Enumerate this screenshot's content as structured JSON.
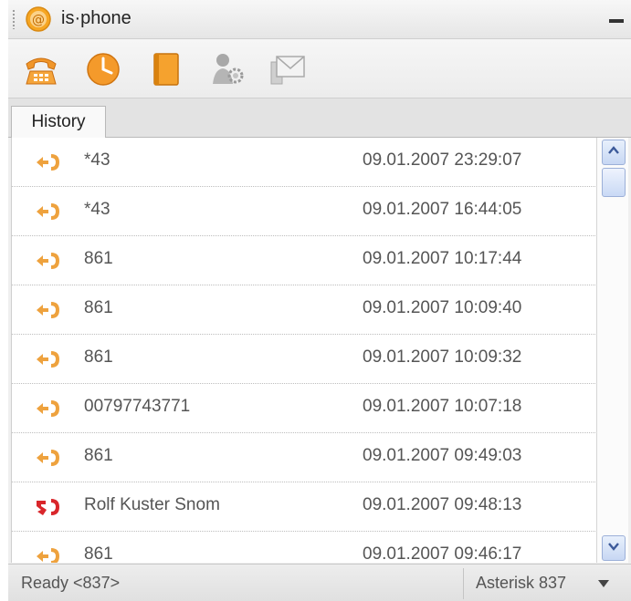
{
  "app": {
    "title": "is·phone"
  },
  "toolbar": {
    "buttons": [
      {
        "icon": "phone-icon"
      },
      {
        "icon": "clock-icon"
      },
      {
        "icon": "address-book-icon"
      },
      {
        "icon": "settings-user-icon"
      },
      {
        "icon": "mail-icon"
      }
    ]
  },
  "tabs": [
    {
      "label": "History"
    }
  ],
  "history": [
    {
      "type": "incoming",
      "name": "*43",
      "time": "09.01.2007 23:29:07"
    },
    {
      "type": "incoming",
      "name": "*43",
      "time": "09.01.2007 16:44:05"
    },
    {
      "type": "incoming",
      "name": "861",
      "time": "09.01.2007 10:17:44"
    },
    {
      "type": "incoming",
      "name": "861",
      "time": "09.01.2007 10:09:40"
    },
    {
      "type": "incoming",
      "name": "861",
      "time": "09.01.2007 10:09:32"
    },
    {
      "type": "incoming",
      "name": "00797743771",
      "time": "09.01.2007 10:07:18"
    },
    {
      "type": "incoming",
      "name": "861",
      "time": "09.01.2007 09:49:03"
    },
    {
      "type": "missed",
      "name": "Rolf Kuster Snom",
      "time": "09.01.2007 09:48:13"
    },
    {
      "type": "incoming",
      "name": "861",
      "time": "09.01.2007 09:46:17"
    }
  ],
  "status": {
    "text": "Ready <837>",
    "account": "Asterisk 837"
  },
  "colors": {
    "accent": "#f0a43a",
    "missed": "#d9262b",
    "scroll": "#c9d9f5"
  }
}
